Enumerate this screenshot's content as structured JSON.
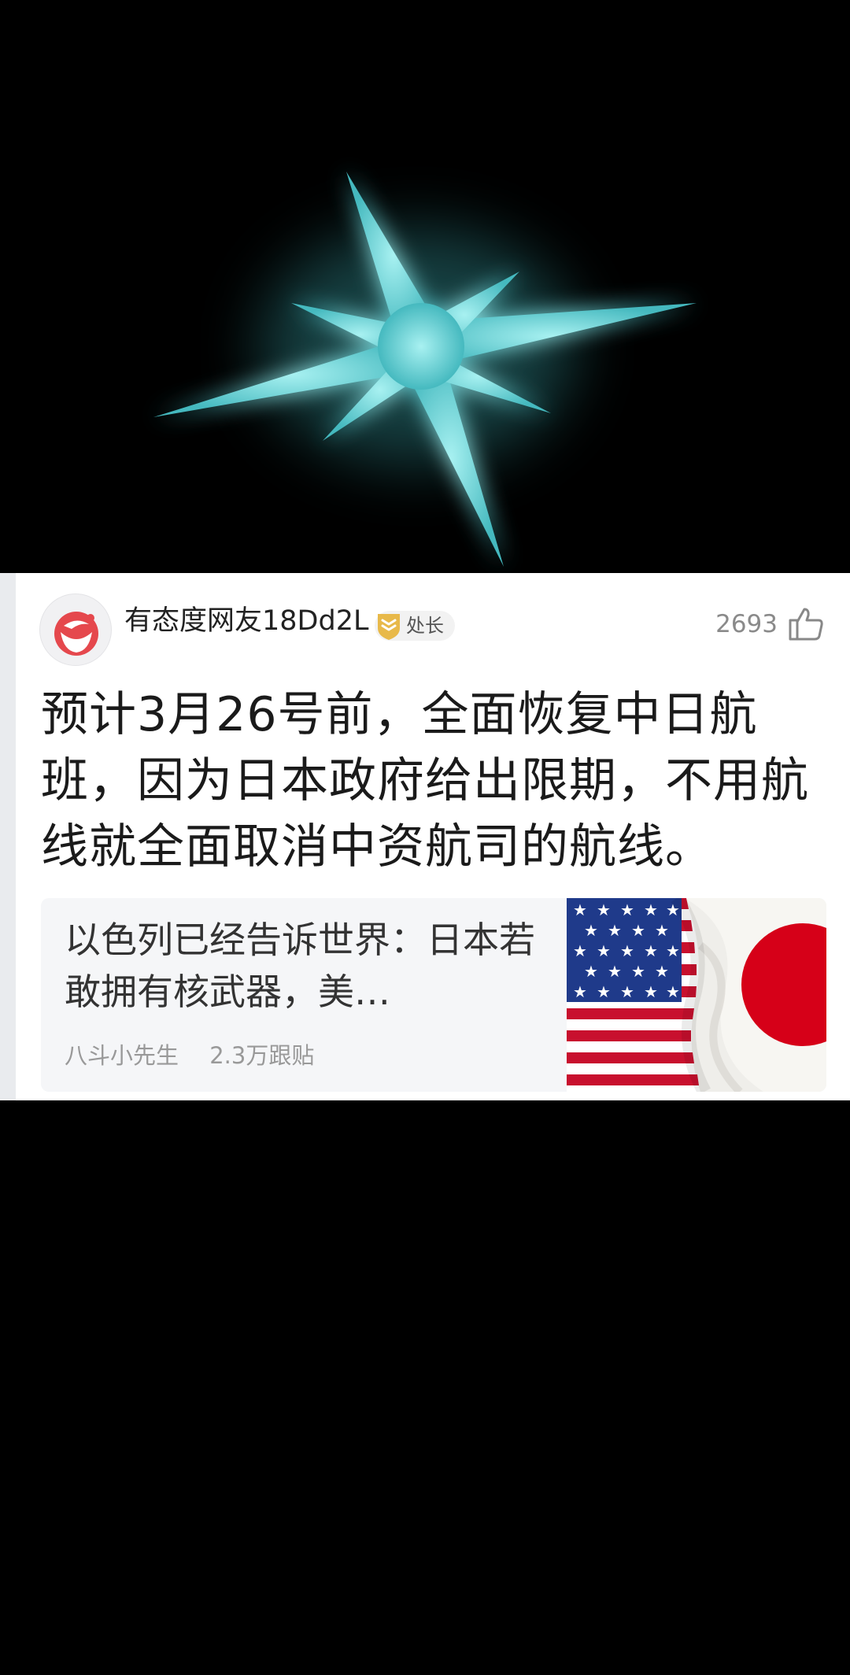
{
  "header_visual": {
    "icon": "glowing-star-icon",
    "background_color": "#000000",
    "glow_color": "#5fd3d6"
  },
  "comment": {
    "avatar_icon": "app-logo-avatar-icon",
    "username": "有态度网友18Dd2L",
    "rank_badge": {
      "icon": "shield-rank-icon",
      "label": "处长",
      "color": "#e8b94a"
    },
    "like_count": "2693",
    "like_icon": "thumbs-up-icon",
    "text": "预计3月26号前，全面恢复中日航班，因为日本政府给出限期，不用航线就全面取消中资航司的航线。"
  },
  "linked_article": {
    "title": "以色列已经告诉世界：日本若敢拥有核武器，美…",
    "author": "八斗小先生",
    "follow_count": "2.3万跟贴",
    "thumbnail_icon": "us-japan-flags-thumbnail",
    "colors": {
      "us_red": "#c8102e",
      "us_blue": "#1f3a8a",
      "japan_red": "#d60018"
    }
  }
}
